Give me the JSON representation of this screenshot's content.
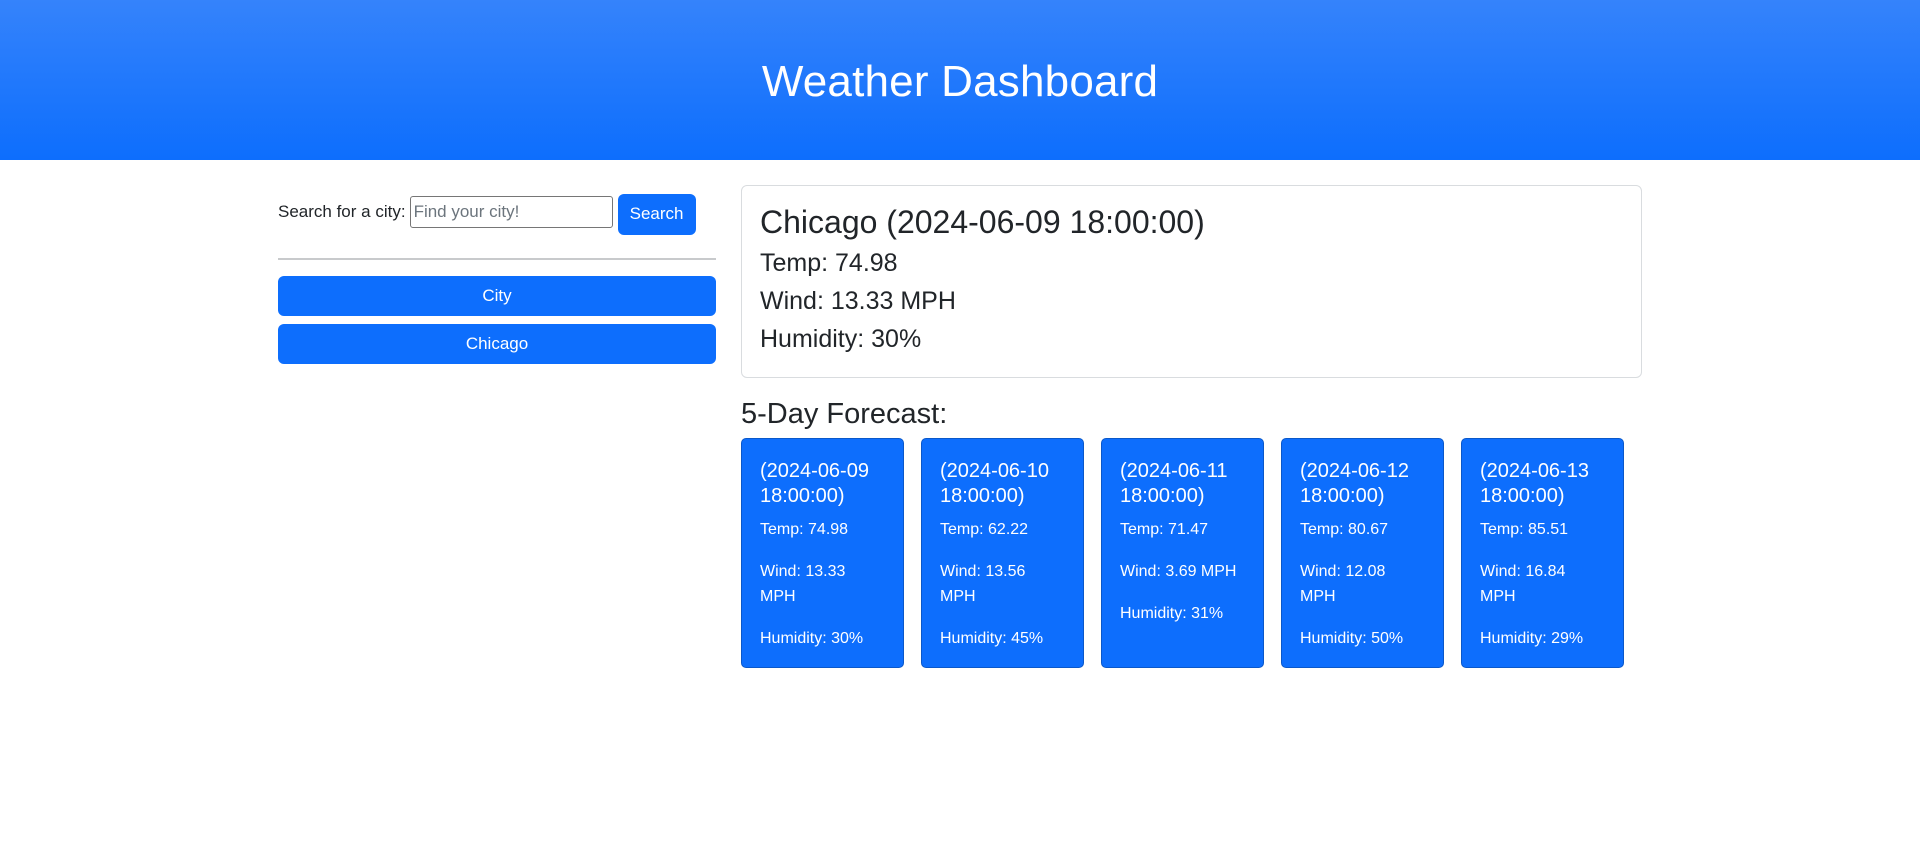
{
  "header": {
    "title": "Weather Dashboard"
  },
  "search": {
    "label": "Search for a city:",
    "placeholder": "Find your city!",
    "value": "",
    "button_label": "Search"
  },
  "history": [
    {
      "label": "City"
    },
    {
      "label": "Chicago"
    }
  ],
  "current": {
    "title": "Chicago (2024-06-09 18:00:00)",
    "temp": "Temp: 74.98",
    "wind": "Wind: 13.33 MPH",
    "humidity": "Humidity: 30%"
  },
  "forecast": {
    "heading": "5-Day Forecast:",
    "days": [
      {
        "date": "(2024-06-09 18:00:00)",
        "temp": "Temp: 74.98",
        "wind": "Wind: 13.33 MPH",
        "humidity": "Humidity: 30%"
      },
      {
        "date": "(2024-06-10 18:00:00)",
        "temp": "Temp: 62.22",
        "wind": "Wind: 13.56 MPH",
        "humidity": "Humidity: 45%"
      },
      {
        "date": "(2024-06-11 18:00:00)",
        "temp": "Temp: 71.47",
        "wind": "Wind: 3.69 MPH",
        "humidity": "Humidity: 31%"
      },
      {
        "date": "(2024-06-12 18:00:00)",
        "temp": "Temp: 80.67",
        "wind": "Wind: 12.08 MPH",
        "humidity": "Humidity: 50%"
      },
      {
        "date": "(2024-06-13 18:00:00)",
        "temp": "Temp: 85.51",
        "wind": "Wind: 16.84 MPH",
        "humidity": "Humidity: 29%"
      }
    ]
  },
  "colors": {
    "primary": "#0d6efd",
    "header_gradient_top": "#3583fb",
    "text": "#212529"
  }
}
